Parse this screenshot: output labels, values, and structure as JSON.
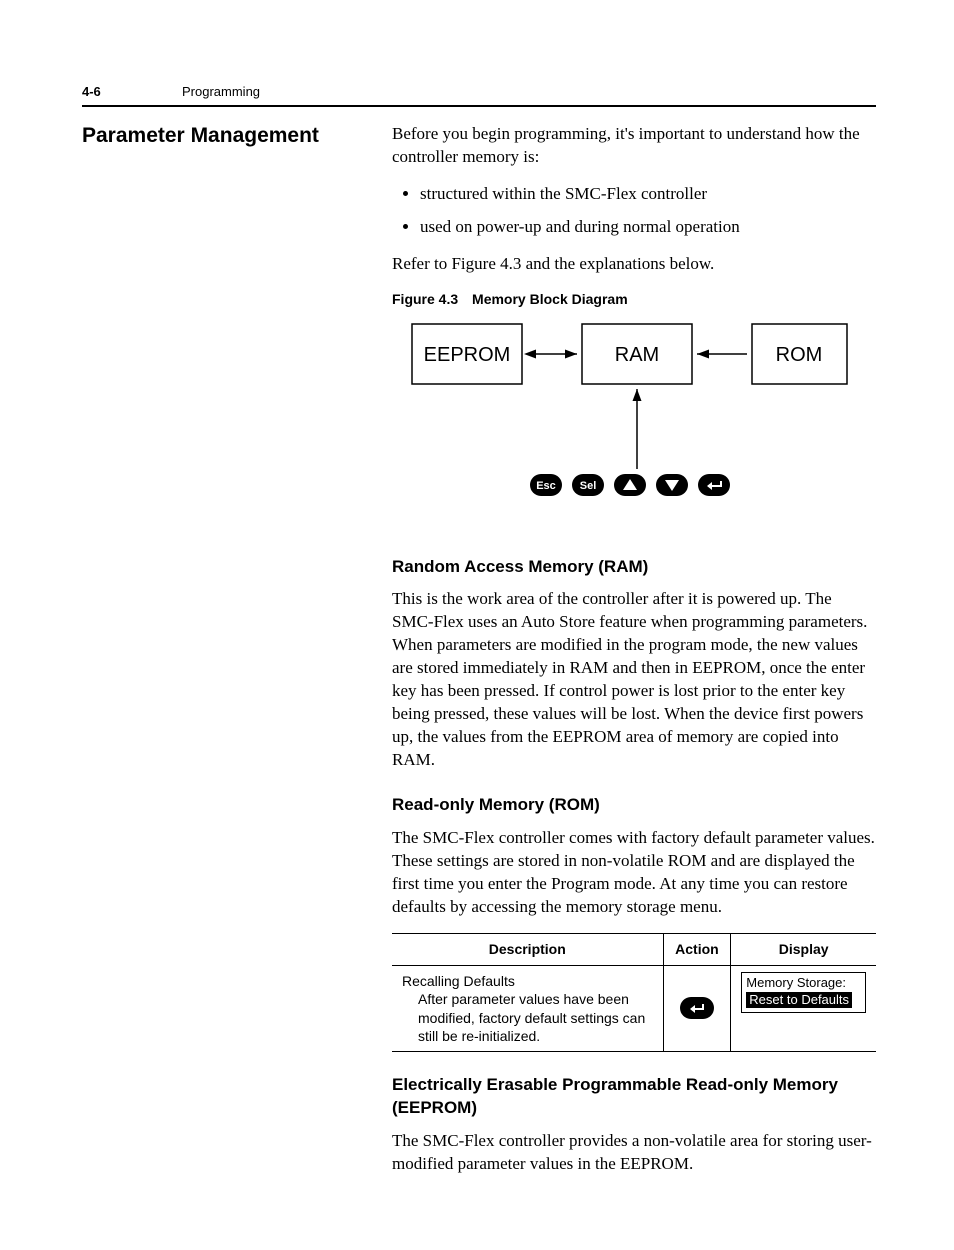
{
  "running_head": {
    "page_num": "4-6",
    "section": "Programming"
  },
  "side_heading": "Parameter Management",
  "intro_para": "Before you begin programming, it's important to understand how the controller memory is:",
  "bullets": [
    "structured within the SMC-Flex controller",
    "used on power-up and during normal operation"
  ],
  "refer_line": "Refer to Figure 4.3 and the explanations below.",
  "figure": {
    "num": "Figure 4.3",
    "title": "Memory Block Diagram",
    "blocks": {
      "eeprom": "EEPROM",
      "ram": "RAM",
      "rom": "ROM"
    },
    "keys": {
      "esc": "Esc",
      "sel": "Sel"
    }
  },
  "ram": {
    "heading": "Random Access Memory (RAM)",
    "body": "This is the work area of the controller after it is powered up. The SMC-Flex uses an Auto Store feature when programming parameters. When parameters are modified in the program mode, the new values are stored immediately in RAM and then in EEPROM, once the enter key has been pressed. If control power is lost prior to the enter key being pressed, these values will be lost. When the device first powers up, the values from the EEPROM area of memory are copied into RAM."
  },
  "rom": {
    "heading": "Read-only Memory (ROM)",
    "body": "The SMC-Flex controller comes with factory default parameter values. These settings are stored in non-volatile ROM and are displayed the first time you enter the Program mode. At any time you can restore defaults by accessing the memory storage menu."
  },
  "table": {
    "headers": {
      "desc": "Description",
      "action": "Action",
      "display": "Display"
    },
    "row": {
      "title": "Recalling Defaults",
      "sub": "After parameter values have been modified, factory default settings can still be re-initialized.",
      "display_line1": "Memory Storage:",
      "display_line2": "Reset to Defaults"
    }
  },
  "eeprom": {
    "heading": "Electrically Erasable Programmable Read-only Memory (EEPROM)",
    "body": "The SMC-Flex controller provides a non-volatile area for storing user-modified parameter values in the EEPROM."
  }
}
